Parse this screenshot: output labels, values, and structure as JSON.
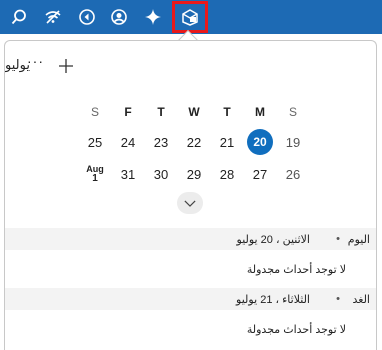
{
  "taskbar": {
    "icons": [
      "search-icon",
      "wifi-off-icon",
      "back-icon",
      "account-icon",
      "sparkle-icon",
      "calendar-app-icon"
    ],
    "highlight_color": "#e8191b",
    "background": "#1d6ab4"
  },
  "calendar": {
    "month_label": "يوليو",
    "more_label": "···",
    "add_label": "+",
    "weekday_headers": [
      "S",
      "M",
      "T",
      "W",
      "T",
      "F",
      "S"
    ],
    "weeks": [
      [
        "19",
        "20",
        "21",
        "22",
        "23",
        "24",
        "25"
      ],
      [
        "26",
        "27",
        "28",
        "29",
        "30",
        "31",
        "1"
      ]
    ],
    "today": "20",
    "next_month_abbr": "Aug",
    "accent": "#106ebe"
  },
  "agenda": {
    "days": [
      {
        "name": "اليوم",
        "bullet": "•",
        "date": "الاثنين ، 20 يوليو",
        "empty_text": "لا توجد أحداث مجدولة"
      },
      {
        "name": "الغد",
        "bullet": "•",
        "date": "الثلاثاء ، 21 يوليو",
        "empty_text": "لا توجد أحداث مجدولة"
      }
    ]
  }
}
